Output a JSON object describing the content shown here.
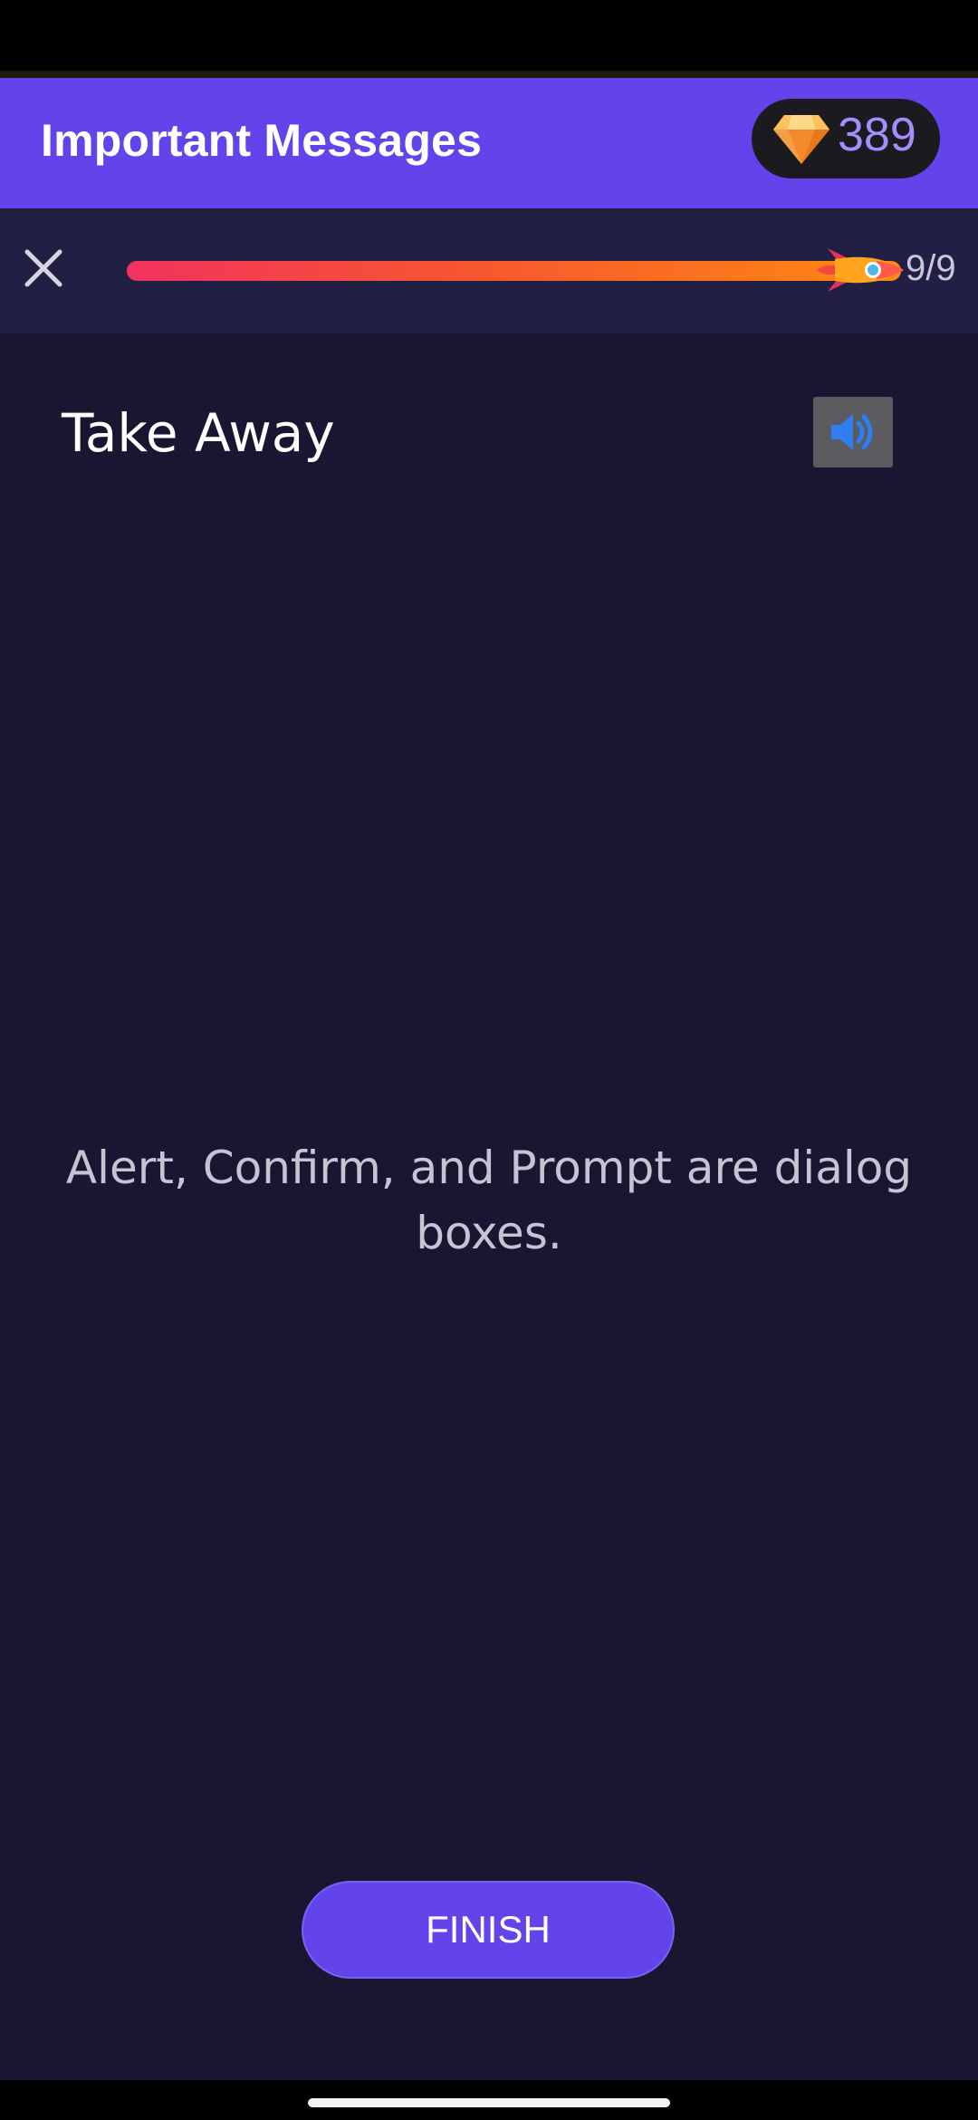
{
  "header": {
    "title": "Important Messages",
    "gem_count": "389",
    "gem_icon": "diamond-icon"
  },
  "progress": {
    "current": 9,
    "total": 9,
    "fraction": 1.0,
    "label": "9/9",
    "close_icon": "close-icon",
    "marker_icon": "rocket-icon"
  },
  "card": {
    "title": "Take Away",
    "audio_icon": "speaker-icon",
    "body": "Alert, Confirm, and Prompt are dialog boxes."
  },
  "actions": {
    "finish_label": "FINISH"
  },
  "colors": {
    "accent": "#6244ea",
    "background": "#181630",
    "progress_start": "#f2325e",
    "progress_end": "#ff8a10",
    "gem": "#a58cff"
  }
}
